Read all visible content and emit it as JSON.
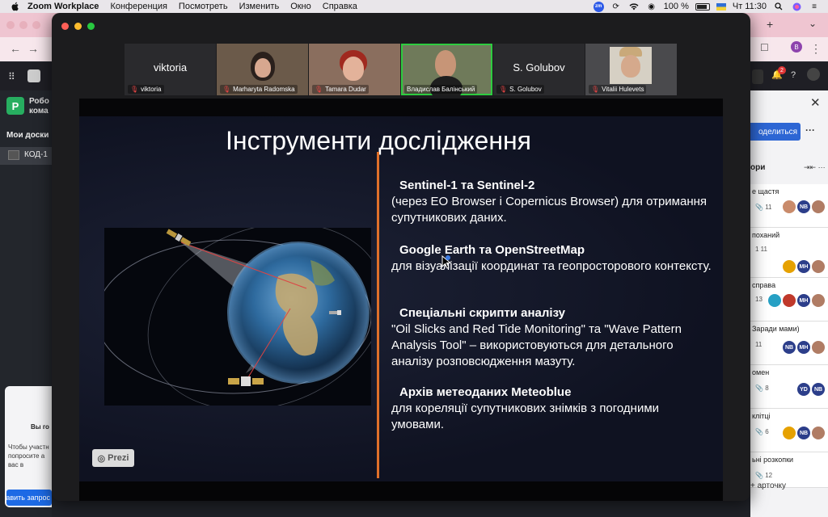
{
  "menubar": {
    "app_name": "Zoom Workplace",
    "items": [
      "Конференция",
      "Посмотреть",
      "Изменить",
      "Окно",
      "Справка"
    ],
    "battery": "100 %",
    "clock": "Чт 11:30"
  },
  "browser": {
    "profile_initial": "B",
    "workspace_initial": "P",
    "workspace_name": "Робо\nкома",
    "my_boards": "Мои доски",
    "board_name": "КОД-1",
    "notification_count": "2",
    "invite": {
      "title": "Вы го",
      "text": "Чтобы участн попросите а вас в",
      "button": "Отправить запрос"
    },
    "panel": {
      "share_button": "оделиться",
      "list_title": "ори",
      "add_card": "арточку",
      "cards": [
        {
          "title": "е щастя",
          "meta": "11",
          "avatars": [
            "",
            "NB",
            ""
          ]
        },
        {
          "title": "поханий",
          "meta": "1     11",
          "avatars": [
            "",
            "MH",
            ""
          ]
        },
        {
          "title": "справа",
          "meta": "13",
          "avatars": [
            "",
            "",
            "MH",
            ""
          ]
        },
        {
          "title": "Заради мами)",
          "meta": "11",
          "avatars": [
            "NB",
            "MH",
            ""
          ]
        },
        {
          "title": "омен",
          "meta": "8",
          "avatars": [
            "YD",
            "NB"
          ]
        },
        {
          "title": "клітці",
          "meta": "6",
          "avatars": [
            "",
            "NB",
            ""
          ]
        },
        {
          "title": "ьні розкопки",
          "meta": "12",
          "avatars": []
        }
      ]
    }
  },
  "zoom": {
    "participants": [
      {
        "name": "viktoria",
        "display": "viktoria",
        "video": false
      },
      {
        "name": "Marharyta Radomska",
        "video": true
      },
      {
        "name": "Tamara Dudar",
        "video": true
      },
      {
        "name": "Владислав Балінський",
        "video": true,
        "active_speaker": true
      },
      {
        "name": "S. Golubov",
        "display": "S. Golubov",
        "video": false
      },
      {
        "name": "Vitalii Hulevets",
        "video": true
      }
    ]
  },
  "slide": {
    "title": "Інструменти дослідження",
    "prezi_label": "Prezi",
    "bullets": [
      {
        "heading": "Sentinel-1 та Sentinel-2",
        "text": "(через EO Browser і Copernicus Browser) для отримання супутникових даних."
      },
      {
        "heading": "Google Earth та OpenStreetMap",
        "text": "для візуалізації координат та геопросторового контексту."
      },
      {
        "heading": "Спеціальні скрипти аналізу",
        "text": "\"Oil Slicks and Red Tide Monitoring\" та \"Wave Pattern Analysis Tool\" – використовуються для детального аналізу розповсюдження мазуту."
      },
      {
        "heading": "Архів метеоданих Meteoblue",
        "text": "для кореляції супутникових знімків з погодними умовами."
      }
    ]
  }
}
